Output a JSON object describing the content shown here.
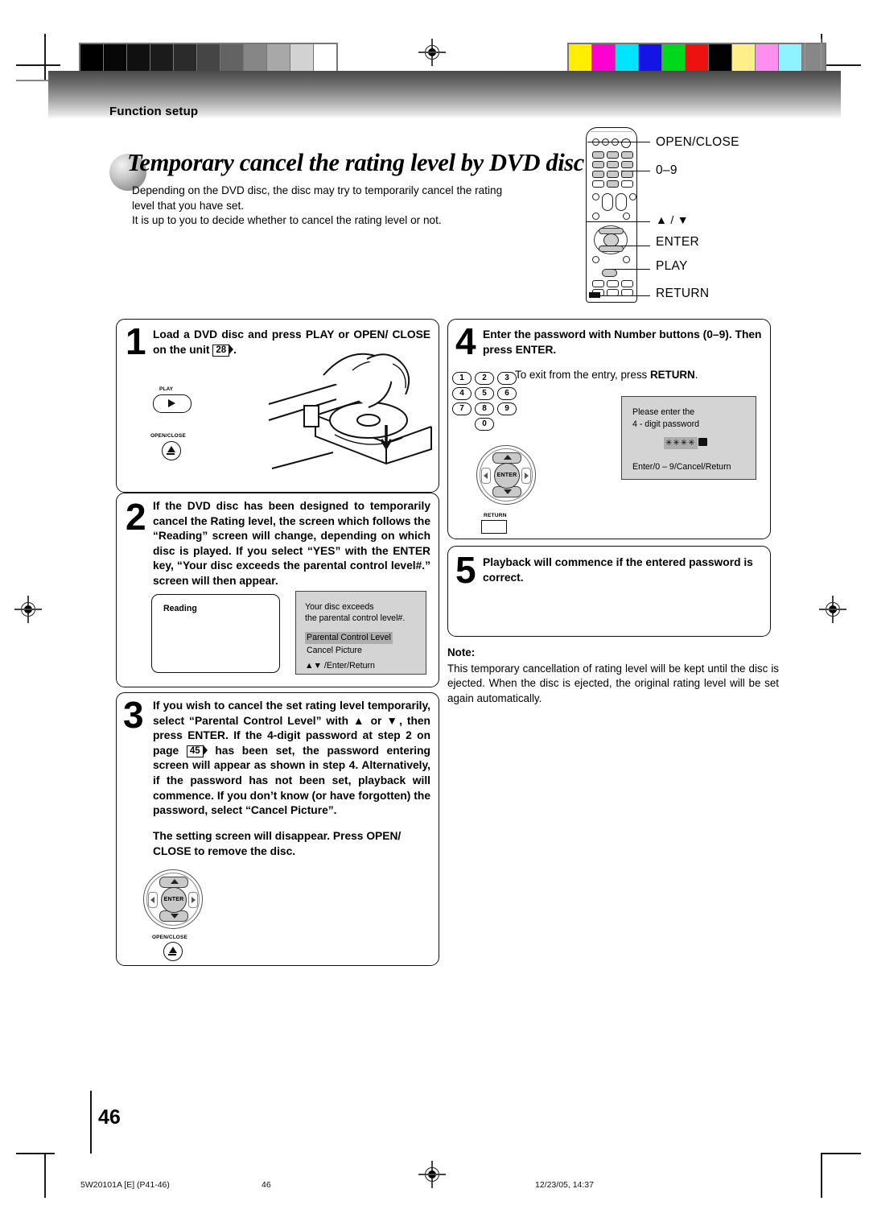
{
  "page": {
    "section_label": "Function setup",
    "title": "Temporary cancel the rating level by DVD disc",
    "intro_line1": "Depending on the DVD disc, the disc may try to temporarily cancel the rating",
    "intro_line2": "level that you have set.",
    "intro_line3": "It is up to you to decide whether to cancel the rating level or not.",
    "page_number": "46"
  },
  "remote_callouts": [
    {
      "label": "OPEN/CLOSE"
    },
    {
      "label": "0–9"
    },
    {
      "label": "▲ / ▼"
    },
    {
      "label": "ENTER"
    },
    {
      "label": "PLAY"
    },
    {
      "label": "RETURN"
    }
  ],
  "steps": [
    {
      "number": "1",
      "text_a": "Load a DVD disc and press PLAY or OPEN/ CLOSE on the unit ",
      "pageref": "28",
      "text_b": "."
    },
    {
      "number": "2",
      "text": "If the DVD disc has been designed to temporarily cancel the Rating level, the screen which follows the “Reading” screen will change, depending on which disc is played. If you select “YES” with the ENTER key, “Your disc exceeds the parental control level#.” screen will then appear."
    },
    {
      "number": "3",
      "text_a": "If you wish to cancel the set rating level temporarily, select “Parental Control Level” with ▲ or ▼, then press ENTER. If the 4-digit password at step 2 on page ",
      "pageref": "45",
      "text_b": " has been set, the password entering screen will appear as shown in step 4. Alternatively, if the password has not been set, playback will commence. If you don’t know (or have forgotten) the password, select “Cancel Picture”.",
      "text_c": "The setting screen will disappear. Press OPEN/ CLOSE to remove the disc."
    },
    {
      "number": "4",
      "text": "Enter the password with Number buttons (0–9). Then press ENTER.",
      "sub_a": "To exit from the entry, press ",
      "sub_b": "RETURN",
      "sub_c": "."
    },
    {
      "number": "5",
      "text": "Playback will commence if the entered password is correct."
    }
  ],
  "unit_buttons": {
    "play_label": "PLAY",
    "open_close_label": "OPEN/CLOSE"
  },
  "osd": {
    "reading": {
      "text": "Reading"
    },
    "exceeds": {
      "line1": "Your disc exceeds",
      "line2": "the parental control level#.",
      "option_selected": "Parental Control Level",
      "option_other": "Cancel Picture",
      "hint": "▲▼ /Enter/Return"
    },
    "password": {
      "line1": "Please enter the",
      "line2": "4 - digit password",
      "masked": "✳✳✳✳",
      "hint": "Enter/0 – 9/Cancel/Return"
    }
  },
  "keypad": {
    "keys": [
      "1",
      "2",
      "3",
      "4",
      "5",
      "6",
      "7",
      "8",
      "9",
      "0"
    ],
    "enter_label": "ENTER",
    "return_label": "RETURN"
  },
  "note": {
    "heading": "Note:",
    "body": "This temporary cancellation of rating level will be kept until the disc is ejected. When the disc is ejected, the original rating level will be set again automatically."
  },
  "footer": {
    "job_code": "5W20101A [E] (P41-46)",
    "page": "46",
    "timestamp": "12/23/05, 14:37"
  },
  "calibration": {
    "grayscale": [
      "#000000",
      "#070707",
      "#101010",
      "#1b1b1b",
      "#2b2b2b",
      "#454545",
      "#636363",
      "#868686",
      "#a8a8a8",
      "#d2d2d2",
      "#ffffff"
    ],
    "colorbars": [
      "#ffee00",
      "#ff00d0",
      "#00e5ff",
      "#1414e6",
      "#00d81e",
      "#ee1111",
      "#000000",
      "#ffef8a",
      "#ff8ef0",
      "#8ef3ff",
      "#878787"
    ]
  }
}
